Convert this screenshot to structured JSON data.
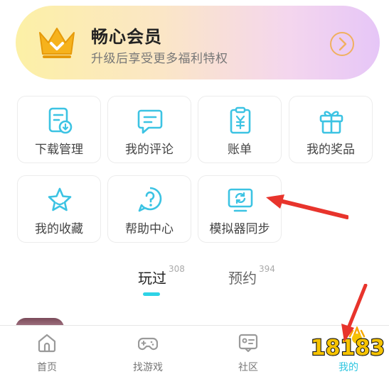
{
  "vip": {
    "title": "畅心会员",
    "subtitle": "升级后享受更多福利特权"
  },
  "grid": [
    {
      "label": "下载管理",
      "icon": "download-doc-icon"
    },
    {
      "label": "我的评论",
      "icon": "comment-icon"
    },
    {
      "label": "账单",
      "icon": "bill-icon"
    },
    {
      "label": "我的奖品",
      "icon": "gift-icon"
    },
    {
      "label": "我的收藏",
      "icon": "star-icon"
    },
    {
      "label": "帮助中心",
      "icon": "help-icon"
    },
    {
      "label": "模拟器同步",
      "icon": "emulator-sync-icon"
    }
  ],
  "tabs": {
    "played": {
      "label": "玩过",
      "count": "308"
    },
    "reserved": {
      "label": "预约",
      "count": "394"
    }
  },
  "bottom_nav": [
    {
      "label": "首页",
      "icon": "home-icon"
    },
    {
      "label": "找游戏",
      "icon": "gamepad-icon"
    },
    {
      "label": "社区",
      "icon": "community-icon"
    },
    {
      "label": "我的",
      "icon": "profile-icon"
    }
  ],
  "watermark": "18183",
  "colors": {
    "accent": "#2ed3e6",
    "icon": "#3cc3e3",
    "annotation_red": "#e8342c",
    "vip_gold": "#f6b21c"
  }
}
